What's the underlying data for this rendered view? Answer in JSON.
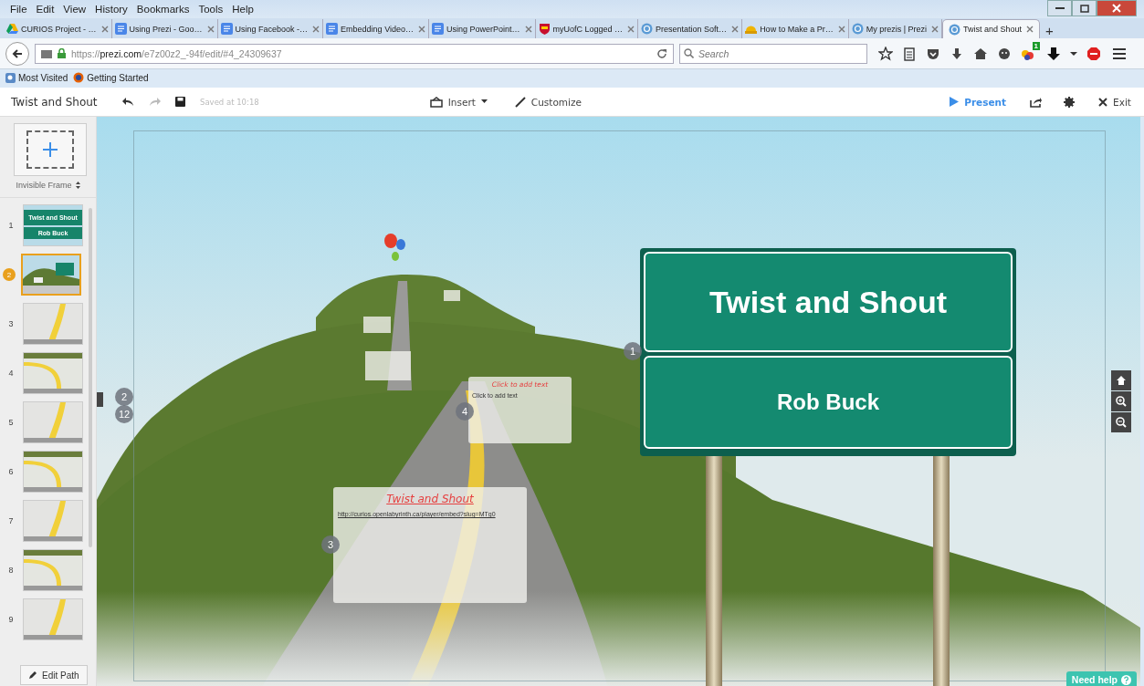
{
  "menu": [
    "File",
    "Edit",
    "View",
    "History",
    "Bookmarks",
    "Tools",
    "Help"
  ],
  "tabs": [
    {
      "label": "CURIOS Project - …",
      "kind": "drive",
      "selected": false
    },
    {
      "label": "Using Prezi - Goo…",
      "kind": "doc",
      "selected": false
    },
    {
      "label": "Using Facebook -…",
      "kind": "doc",
      "selected": false
    },
    {
      "label": "Embedding Video…",
      "kind": "doc",
      "selected": false
    },
    {
      "label": "Using PowerPoint…",
      "kind": "doc",
      "selected": false
    },
    {
      "label": "myUofC Logged …",
      "kind": "crest",
      "selected": false
    },
    {
      "label": "Presentation Soft…",
      "kind": "prezi",
      "selected": false
    },
    {
      "label": "How to Make a Pr…",
      "kind": "hardhat",
      "selected": false
    },
    {
      "label": "My prezis | Prezi",
      "kind": "prezi",
      "selected": false
    },
    {
      "label": "Twist and Shout",
      "kind": "prezi",
      "selected": true
    }
  ],
  "new_tab": "+",
  "address": {
    "scheme": "https://",
    "host": "prezi.com",
    "path": "/e7z00z2_-94f/edit/#4_24309637"
  },
  "search": {
    "placeholder": "Search"
  },
  "extension_badge": "1",
  "bookmarks": [
    {
      "label": "Most Visited",
      "kind": "folder"
    },
    {
      "label": "Getting Started",
      "kind": "firefox"
    }
  ],
  "editor": {
    "title": "Twist and Shout",
    "saved": "Saved at 10:18",
    "insert": "Insert",
    "customize": "Customize",
    "present": "Present",
    "exit": "Exit"
  },
  "sidebar": {
    "frame_type": "Invisible Frame",
    "edit_path": "Edit Path",
    "slides": [
      {
        "number": "1",
        "kind": "title",
        "title": "Twist and Shout",
        "subtitle": "Rob Buck",
        "selected": false
      },
      {
        "number": "2",
        "kind": "scene",
        "selected": true
      },
      {
        "number": "3",
        "kind": "road",
        "selected": false
      },
      {
        "number": "4",
        "kind": "curve",
        "selected": false
      },
      {
        "number": "5",
        "kind": "road",
        "selected": false
      },
      {
        "number": "6",
        "kind": "curve",
        "selected": false
      },
      {
        "number": "7",
        "kind": "road",
        "selected": false
      },
      {
        "number": "8",
        "kind": "curve",
        "selected": false
      },
      {
        "number": "9",
        "kind": "road",
        "selected": false
      }
    ]
  },
  "canvas": {
    "sign": {
      "title": "Twist and Shout",
      "subtitle": "Rob Buck"
    },
    "path_points": [
      "1",
      "2",
      "12",
      "3",
      "4"
    ],
    "frames": [
      {
        "kind": "note",
        "heading": "Click to add text",
        "body": "Click to add text"
      },
      {
        "kind": "link",
        "heading": "Twist and Shout",
        "body": "http://curios.openlabyrinth.ca/player/embed?slug=MTg0"
      }
    ]
  },
  "help": "Need help"
}
